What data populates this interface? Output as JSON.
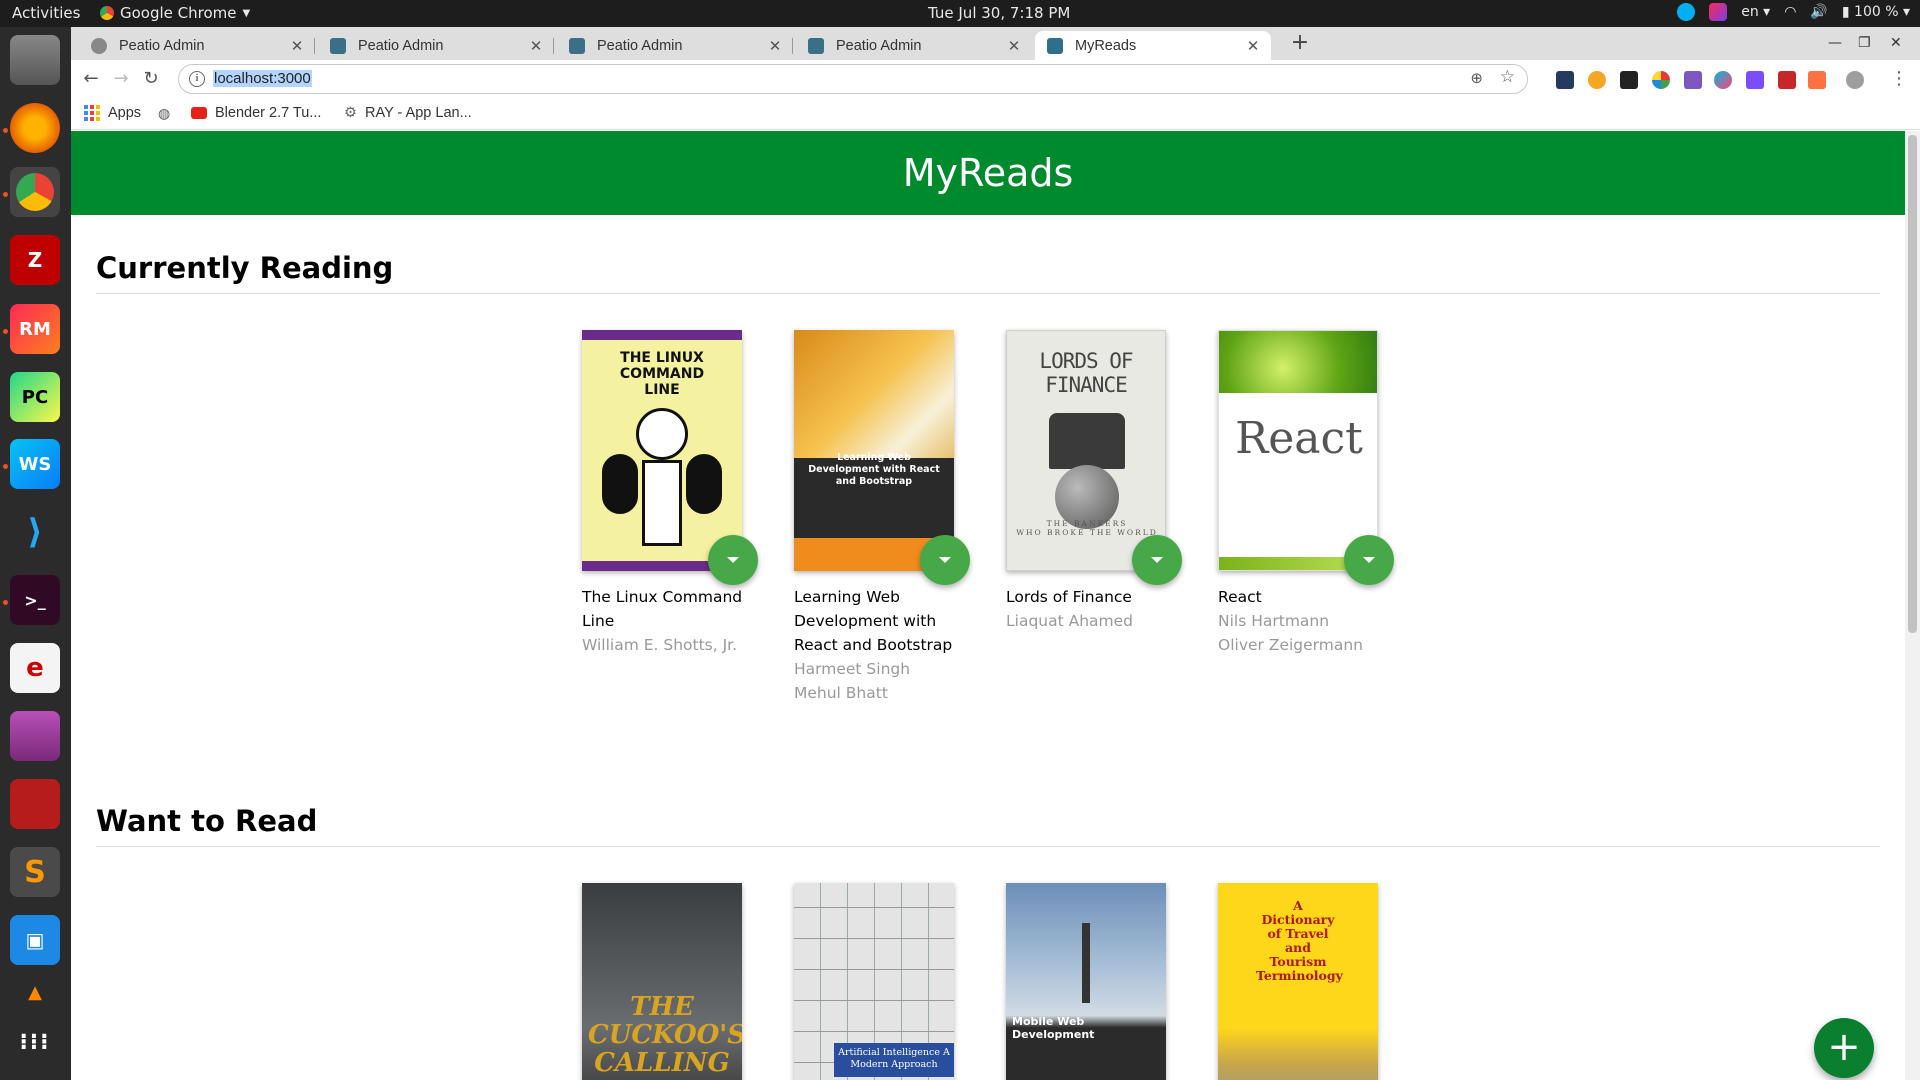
{
  "system": {
    "activities": "Activities",
    "app_name": "Google Chrome",
    "clock": "Tue Jul 30,  7:18 PM",
    "language": "en",
    "battery": "100 %"
  },
  "tabs": [
    {
      "label": "Peatio Admin"
    },
    {
      "label": "Peatio Admin"
    },
    {
      "label": "Peatio Admin"
    },
    {
      "label": "Peatio Admin"
    },
    {
      "label": "MyReads"
    }
  ],
  "toolbar": {
    "url": "localhost:3000"
  },
  "bookmarks": [
    {
      "label": "Apps"
    },
    {
      "label": "Blender 2.7 Tu..."
    },
    {
      "label": "RAY - App Lan..."
    }
  ],
  "page": {
    "title": "MyReads",
    "fab": "+"
  },
  "shelves": [
    {
      "title": "Currently Reading",
      "books": [
        {
          "title": "The Linux Command Line",
          "authors": [
            "William E. Shotts, Jr."
          ],
          "cover_title": "THE LINUX COMMAND LINE"
        },
        {
          "title": "Learning Web Development with React and Bootstrap",
          "authors": [
            "Harmeet Singh",
            "Mehul Bhatt"
          ],
          "cover_title": "Learning Web Development with React and Bootstrap"
        },
        {
          "title": "Lords of Finance",
          "authors": [
            "Liaquat Ahamed"
          ],
          "cover_title": "LORDS OF FINANCE"
        },
        {
          "title": "React",
          "authors": [
            "Nils Hartmann",
            "Oliver Zeigermann"
          ],
          "cover_title": "React"
        }
      ]
    },
    {
      "title": "Want to Read",
      "books": [
        {
          "cover_title": "THE CUCKOO'S CALLING"
        },
        {
          "cover_title": "Artificial Intelligence A Modern Approach"
        },
        {
          "cover_title": "Mobile Web Development"
        },
        {
          "cover_title": "A Dictionary of Travel and Tourism Terminology"
        }
      ]
    }
  ]
}
